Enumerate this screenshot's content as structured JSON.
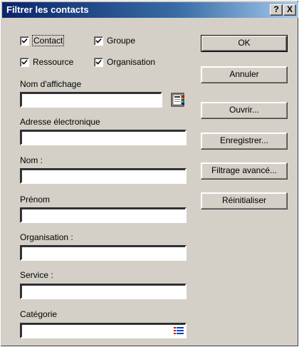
{
  "window": {
    "title": "Filtrer les contacts",
    "help_label": "?",
    "close_label": "X"
  },
  "checkboxes": [
    {
      "label": "Contact",
      "checked": true
    },
    {
      "label": "Groupe",
      "checked": true
    },
    {
      "label": "Ressource",
      "checked": true
    },
    {
      "label": "Organisation",
      "checked": true
    }
  ],
  "fields": {
    "display_name": {
      "label": "Nom d'affichage",
      "value": ""
    },
    "email": {
      "label": "Adresse électronique",
      "value": ""
    },
    "last_name": {
      "label": "Nom :",
      "value": ""
    },
    "first_name": {
      "label": "Prénom",
      "value": ""
    },
    "organization": {
      "label": "Organisation :",
      "value": ""
    },
    "department": {
      "label": "Service :",
      "value": ""
    },
    "category": {
      "label": "Catégorie",
      "value": ""
    }
  },
  "buttons": {
    "ok": "OK",
    "cancel": "Annuler",
    "open": "Ouvrir...",
    "save": "Enregistrer...",
    "advanced": "Filtrage avancé...",
    "reset": "Réinitialiser"
  },
  "icons": {
    "address_book": "address-book-icon",
    "category_list": "category-list-icon"
  }
}
